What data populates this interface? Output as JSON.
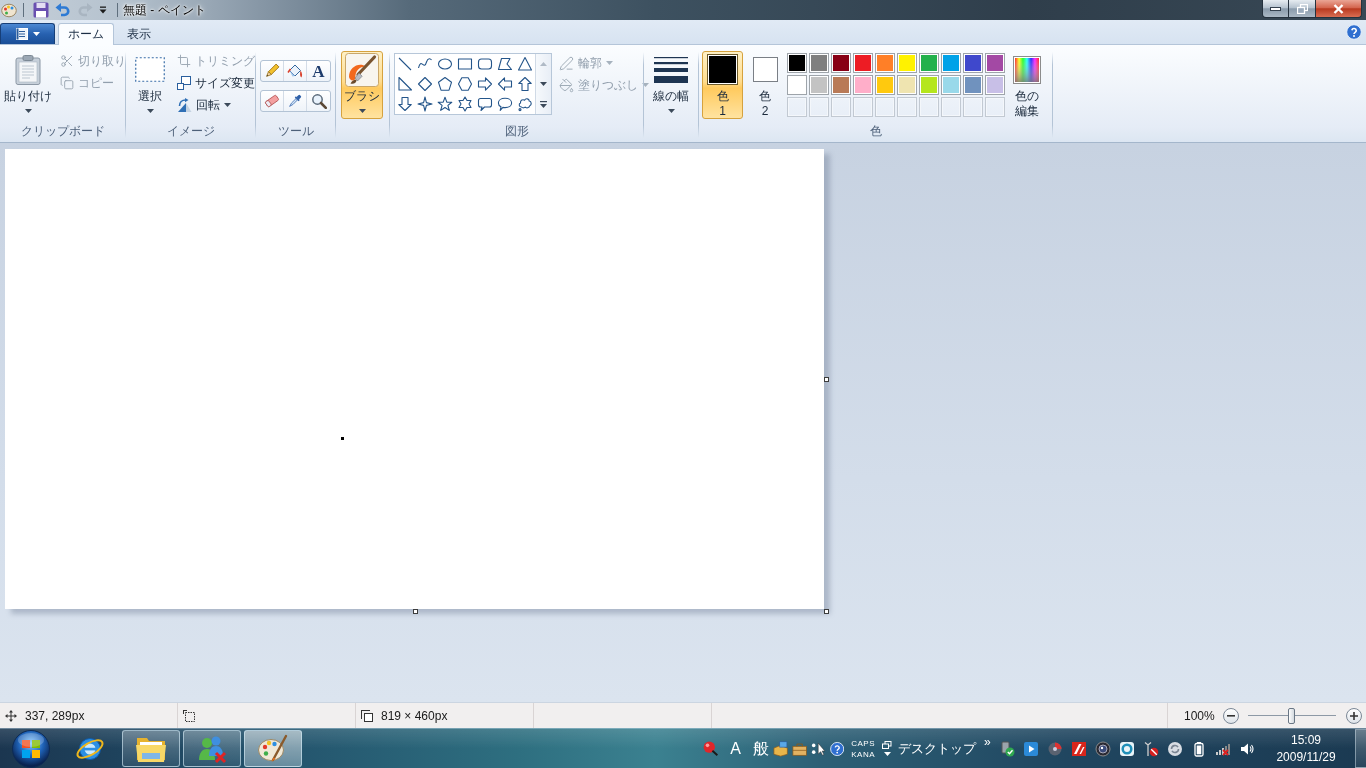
{
  "window": {
    "title": "無題 - ペイント",
    "quick_access": [
      {
        "kind": "save",
        "disabled": false
      },
      {
        "kind": "undo",
        "disabled": false
      },
      {
        "kind": "redo",
        "disabled": true
      },
      {
        "kind": "customize"
      }
    ],
    "controls": [
      {
        "kind": "minimize"
      },
      {
        "kind": "restore"
      },
      {
        "kind": "close"
      }
    ]
  },
  "tabs": [
    {
      "label": "ホーム",
      "selected": true
    },
    {
      "label": "表示",
      "selected": false
    }
  ],
  "ribbon": {
    "clipboard": {
      "label": "クリップボード",
      "paste": {
        "label": "貼り付け",
        "dropdown": true
      },
      "items": [
        {
          "kind": "cut",
          "label": "切り取り",
          "disabled": true,
          "dropdown": false
        },
        {
          "kind": "copy",
          "label": "コピー",
          "disabled": true,
          "dropdown": false
        }
      ]
    },
    "image": {
      "label": "イメージ",
      "select": {
        "label": "選択",
        "dropdown": true
      },
      "items": [
        {
          "kind": "crop",
          "label": "トリミング",
          "disabled": true,
          "dropdown": false
        },
        {
          "kind": "resize",
          "label": "サイズ変更",
          "disabled": false,
          "dropdown": false
        },
        {
          "kind": "rotate",
          "label": "回転",
          "disabled": false,
          "dropdown": true
        }
      ]
    },
    "tools": {
      "label": "ツール",
      "items": [
        {
          "kind": "pencil",
          "selected": false
        },
        {
          "kind": "fill",
          "selected": false
        },
        {
          "kind": "text",
          "glyph": "A",
          "selected": false
        },
        {
          "kind": "eraser",
          "selected": false
        },
        {
          "kind": "picker",
          "selected": false
        },
        {
          "kind": "magnifier",
          "selected": false
        }
      ]
    },
    "brushes": {
      "label": "ブラシ",
      "selected": true,
      "dropdown": true
    },
    "shapes": {
      "label": "図形",
      "gallery": [
        {
          "kind": "line",
          "selected": false
        },
        {
          "kind": "curve",
          "selected": false
        },
        {
          "kind": "oval",
          "selected": false
        },
        {
          "kind": "rectangle",
          "selected": false
        },
        {
          "kind": "rounded_rectangle",
          "selected": false
        },
        {
          "kind": "polygon",
          "selected": false
        },
        {
          "kind": "triangle",
          "selected": false
        },
        {
          "kind": "right_triangle",
          "selected": false
        },
        {
          "kind": "diamond",
          "selected": false
        },
        {
          "kind": "pentagon",
          "selected": false
        },
        {
          "kind": "hexagon",
          "selected": false
        },
        {
          "kind": "right_arrow",
          "selected": false
        },
        {
          "kind": "left_arrow",
          "selected": false
        },
        {
          "kind": "up_arrow",
          "selected": false
        },
        {
          "kind": "down_arrow",
          "selected": false
        },
        {
          "kind": "star4",
          "selected": false
        },
        {
          "kind": "star5",
          "selected": false
        },
        {
          "kind": "star6",
          "selected": false
        },
        {
          "kind": "rounded_callout",
          "selected": false
        },
        {
          "kind": "oval_callout",
          "selected": false
        },
        {
          "kind": "cloud_callout",
          "selected": false
        }
      ],
      "styles": [
        {
          "kind": "outline",
          "label": "輪郭",
          "disabled": true,
          "dropdown": true
        },
        {
          "kind": "fill",
          "label": "塗りつぶし",
          "disabled": true,
          "dropdown": true
        }
      ]
    },
    "size": {
      "label": "線の幅",
      "dropdown": true
    },
    "colors": {
      "label": "色",
      "color1": {
        "label": "色",
        "number": "1",
        "color": "#000000",
        "selected": true
      },
      "color2": {
        "label": "色",
        "number": "2",
        "color": "#ffffff",
        "selected": false
      },
      "palette": [
        {
          "kind": "swatch",
          "color": "#000000"
        },
        {
          "kind": "swatch",
          "color": "#7f7f7f"
        },
        {
          "kind": "swatch",
          "color": "#880015"
        },
        {
          "kind": "swatch",
          "color": "#ed1c24"
        },
        {
          "kind": "swatch",
          "color": "#ff7f27"
        },
        {
          "kind": "swatch",
          "color": "#fff200"
        },
        {
          "kind": "swatch",
          "color": "#22b14c"
        },
        {
          "kind": "swatch",
          "color": "#00a2e8"
        },
        {
          "kind": "swatch",
          "color": "#3f48cc"
        },
        {
          "kind": "swatch",
          "color": "#a349a4"
        },
        {
          "kind": "swatch",
          "color": "#ffffff"
        },
        {
          "kind": "swatch",
          "color": "#c3c3c3"
        },
        {
          "kind": "swatch",
          "color": "#b97a57"
        },
        {
          "kind": "swatch",
          "color": "#ffaec9"
        },
        {
          "kind": "swatch",
          "color": "#ffc90e"
        },
        {
          "kind": "swatch",
          "color": "#efe4b0"
        },
        {
          "kind": "swatch",
          "color": "#b5e61d"
        },
        {
          "kind": "swatch",
          "color": "#99d9ea"
        },
        {
          "kind": "swatch",
          "color": "#7092be"
        },
        {
          "kind": "swatch",
          "color": "#c8bfe7"
        },
        {
          "kind": "empty"
        },
        {
          "kind": "empty"
        },
        {
          "kind": "empty"
        },
        {
          "kind": "empty"
        },
        {
          "kind": "empty"
        },
        {
          "kind": "empty"
        },
        {
          "kind": "empty"
        },
        {
          "kind": "empty"
        },
        {
          "kind": "empty"
        },
        {
          "kind": "empty"
        }
      ],
      "edit": {
        "label": "色の編集"
      }
    }
  },
  "status_bar": {
    "sections": [
      {
        "kind": "position",
        "text": "337, 289px"
      },
      {
        "kind": "selection"
      },
      {
        "kind": "size",
        "text": "819 × 460px"
      },
      {
        "kind": "blank"
      },
      {
        "kind": "blank"
      }
    ],
    "zoom": {
      "text": "100%",
      "level": 0.5
    }
  },
  "taskbar": {
    "programs": [
      {
        "kind": "browser",
        "running": false,
        "selected": false
      },
      {
        "kind": "folder",
        "running": true,
        "selected": false
      },
      {
        "kind": "messenger",
        "running": true,
        "selected": false
      },
      {
        "kind": "paint",
        "running": true,
        "selected": true
      }
    ],
    "language_bar": [
      {
        "kind": "ime"
      },
      {
        "kind": "text",
        "text": "A"
      },
      {
        "kind": "text",
        "text": "般"
      },
      {
        "kind": "dictionary"
      },
      {
        "kind": "toolbox"
      },
      {
        "kind": "pad"
      },
      {
        "kind": "help"
      },
      {
        "kind": "keys",
        "caps": "CAPS",
        "kana": "KANA"
      },
      {
        "kind": "options"
      }
    ],
    "toolbar": {
      "label": "デスクトップ",
      "chevron": "»"
    },
    "tray": [
      {
        "kind": "safe_remove"
      },
      {
        "kind": "player"
      },
      {
        "kind": "disk"
      },
      {
        "kind": "tile"
      },
      {
        "kind": "camera"
      },
      {
        "kind": "ring"
      },
      {
        "kind": "antenna"
      },
      {
        "kind": "sync"
      },
      {
        "kind": "battery"
      },
      {
        "kind": "signal"
      },
      {
        "kind": "volume"
      }
    ],
    "clock": {
      "time": "15:09",
      "date": "2009/11/29"
    }
  }
}
